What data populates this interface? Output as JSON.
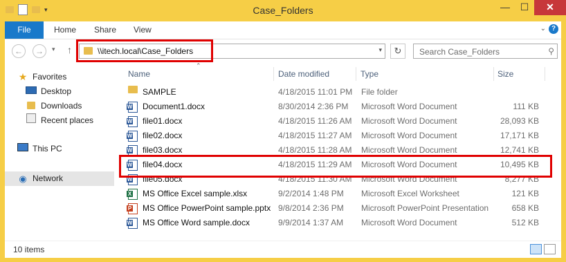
{
  "window": {
    "title": "Case_Folders"
  },
  "ribbon": {
    "file": "File",
    "home": "Home",
    "share": "Share",
    "view": "View"
  },
  "address": {
    "path": "\\\\itech.local\\Case_Folders"
  },
  "search": {
    "placeholder": "Search Case_Folders"
  },
  "nav": {
    "favorites": "Favorites",
    "desktop": "Desktop",
    "downloads": "Downloads",
    "recent": "Recent places",
    "thispc": "This PC",
    "network": "Network"
  },
  "columns": {
    "name": "Name",
    "date": "Date modified",
    "type": "Type",
    "size": "Size"
  },
  "files": [
    {
      "name": "SAMPLE",
      "date": "4/18/2015 11:01 PM",
      "type": "File folder",
      "size": "",
      "icon": "folder-icon"
    },
    {
      "name": "Document1.docx",
      "date": "8/30/2014 2:36 PM",
      "type": "Microsoft Word Document",
      "size": "111 KB",
      "icon": "word-icon"
    },
    {
      "name": "file01.docx",
      "date": "4/18/2015 11:26 AM",
      "type": "Microsoft Word Document",
      "size": "28,093 KB",
      "icon": "word-icon"
    },
    {
      "name": "file02.docx",
      "date": "4/18/2015 11:27 AM",
      "type": "Microsoft Word Document",
      "size": "17,171 KB",
      "icon": "word-icon"
    },
    {
      "name": "file03.docx",
      "date": "4/18/2015 11:28 AM",
      "type": "Microsoft Word Document",
      "size": "12,741 KB",
      "icon": "word-icon"
    },
    {
      "name": "file04.docx",
      "date": "4/18/2015 11:29 AM",
      "type": "Microsoft Word Document",
      "size": "10,495 KB",
      "icon": "word-icon"
    },
    {
      "name": "file05.docx",
      "date": "4/18/2015 11:30 AM",
      "type": "Microsoft Word Document",
      "size": "8,277 KB",
      "icon": "word-icon"
    },
    {
      "name": "MS Office Excel sample.xlsx",
      "date": "9/2/2014 1:48 PM",
      "type": "Microsoft Excel Worksheet",
      "size": "121 KB",
      "icon": "excel-icon"
    },
    {
      "name": "MS Office PowerPoint sample.pptx",
      "date": "9/8/2014 2:36 PM",
      "type": "Microsoft PowerPoint Presentation",
      "size": "658 KB",
      "icon": "powerpoint-icon"
    },
    {
      "name": "MS Office Word sample.docx",
      "date": "9/9/2014 1:37 AM",
      "type": "Microsoft Word Document",
      "size": "512 KB",
      "icon": "word-icon"
    }
  ],
  "status": {
    "count": "10 items"
  },
  "colors": {
    "frame": "#f6ce46",
    "accent": "#1979ca",
    "highlight": "#e00000"
  }
}
